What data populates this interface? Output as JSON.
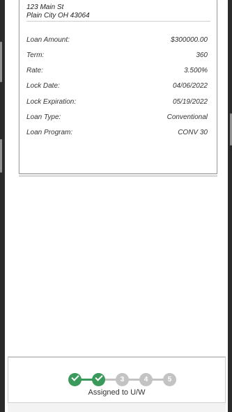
{
  "address": {
    "line1": "123 Main St",
    "line2": "Plain City OH 43064"
  },
  "loan": [
    {
      "label": "Loan Amount:",
      "value": "$300000.00"
    },
    {
      "label": "Term:",
      "value": "360"
    },
    {
      "label": "Rate:",
      "value": "3.500%"
    },
    {
      "label": "Lock Date:",
      "value": "04/06/2022"
    },
    {
      "label": "Lock Expiration:",
      "value": "05/19/2022"
    },
    {
      "label": "Loan Type:",
      "value": "Conventional"
    },
    {
      "label": "Loan Program:",
      "value": "CONV 30"
    }
  ],
  "progress": {
    "status": "Assigned to U/W",
    "completed_steps": 2,
    "total_steps": 5,
    "steps": [
      "1",
      "2",
      "3",
      "4",
      "5"
    ],
    "done_color": "#3a9a5b",
    "todo_color": "#c3c3c3"
  }
}
